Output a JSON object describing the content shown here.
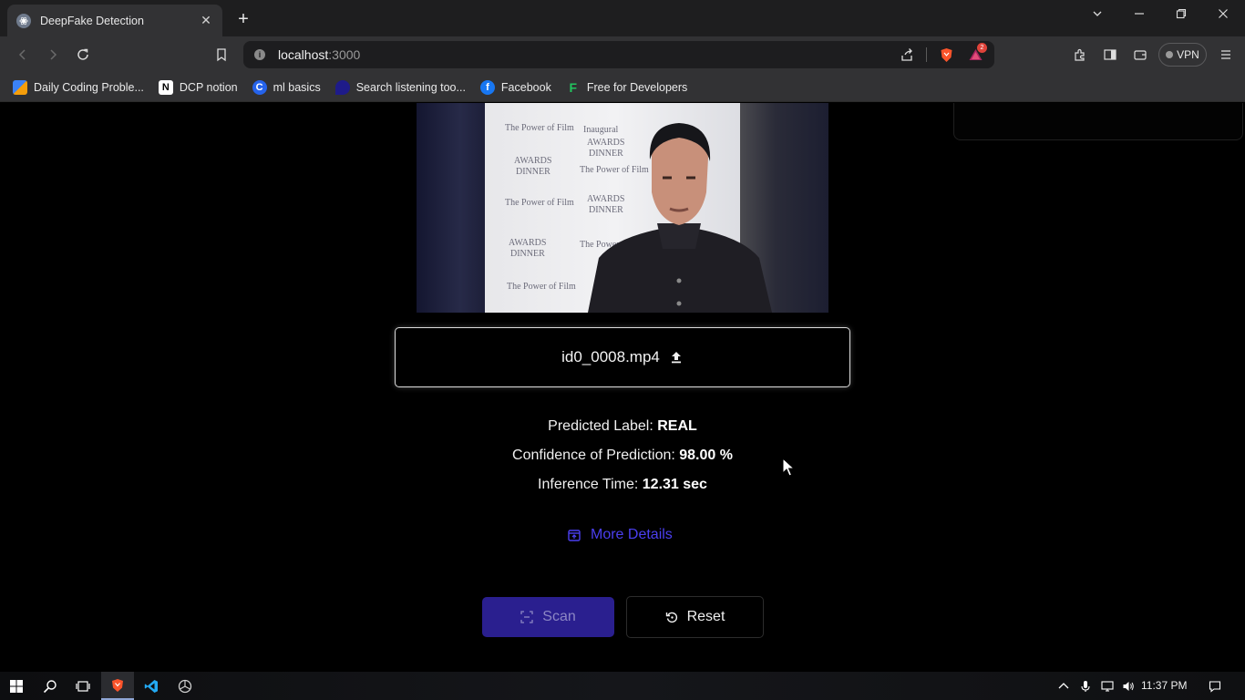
{
  "browser": {
    "tab_title": "DeepFake Detection",
    "url_host": "localhost",
    "url_port": ":3000",
    "rewards_badge": "2",
    "vpn_label": "VPN"
  },
  "bookmarks": [
    {
      "label": "Daily Coding Proble...",
      "icon": "dcp-icon"
    },
    {
      "label": "DCP notion",
      "icon": "notion-icon"
    },
    {
      "label": "ml basics",
      "icon": "c-icon"
    },
    {
      "label": "Search listening too...",
      "icon": "search-listening-icon"
    },
    {
      "label": "Facebook",
      "icon": "facebook-icon"
    },
    {
      "label": "Free for Developers",
      "icon": "f-icon"
    }
  ],
  "video": {
    "backdrop_lines": [
      "The Power of Film",
      "AWARDS",
      "DINNER",
      "Inaugural"
    ]
  },
  "upload": {
    "file_name": "id0_0008.mp4"
  },
  "results": {
    "label_text": "Predicted Label: ",
    "label_value": "REAL",
    "confidence_text": "Confidence of Prediction: ",
    "confidence_value": "98.00 %",
    "time_text": "Inference Time: ",
    "time_value": "12.31 sec"
  },
  "actions": {
    "more_details": "More Details",
    "scan": "Scan",
    "reset": "Reset"
  },
  "taskbar": {
    "clock": "11:37 PM"
  },
  "colors": {
    "accent": "#4b3ff0",
    "scan_bg": "#2a1f8f",
    "page_bg": "#000000"
  }
}
